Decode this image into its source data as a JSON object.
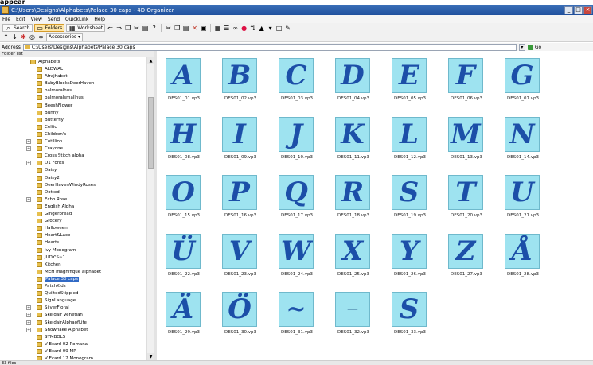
{
  "window": {
    "title": "C:\\Users\\Designs\\Alphabets\\Palace 30 caps - 4D Organizer"
  },
  "menu": [
    "File",
    "Edit",
    "View",
    "Send",
    "QuickLink",
    "Help"
  ],
  "toolbar": {
    "search_label": "Search",
    "folders_label": "Folders",
    "worksheet_label": "Worksheet",
    "accessories_label": "Accessories"
  },
  "address": {
    "label": "Address",
    "value": "C:\\Users\\Designs\\Alphabets\\Palace 30 caps",
    "go_label": "Go"
  },
  "folder_list_header": "Folder list",
  "tree": {
    "root": "Alphabets",
    "folders": [
      "ALDWAL",
      "Afrajhabet",
      "BabyBlocksDeerHaven",
      "balmoralhus",
      "balmoralsmallhus",
      "BeeshFlower",
      "Bunny",
      "Butterfly",
      "Celtic",
      "Children's",
      "Cotillion",
      "Crayone",
      "Cross Stitch alpha",
      "D1 Fonts",
      "Daisy",
      "Daisy2",
      "DeerHavenWindyRoses",
      "Dotted",
      "Echo Rose",
      "English Alpha",
      "Gingerbread",
      "Grocery",
      "Halloween",
      "Heart&Lace",
      "Hearts",
      "Ivy Monogram",
      "JUDY'S~1",
      "Kitchen",
      "MEH magnifique alphabet",
      "Palace 30 caps",
      "PatchKids",
      "QuiltedStippled",
      "SignLanguage",
      "SilverFloral",
      "Skeldair Venetian",
      "SkeldairAlphaofLife",
      "Snowflake Alphabet",
      "SYMBOLS",
      "V Ecard 02 Romana",
      "V Ecard 09 MP",
      "V Ecard 12 Monogram"
    ],
    "selected": "Palace 30 caps"
  },
  "files": [
    {
      "name": "DES01_01.vp3",
      "glyph": "A"
    },
    {
      "name": "DES01_02.vp3",
      "glyph": "B"
    },
    {
      "name": "DES01_03.vp3",
      "glyph": "C"
    },
    {
      "name": "DES01_04.vp3",
      "glyph": "D"
    },
    {
      "name": "DES01_05.vp3",
      "glyph": "E"
    },
    {
      "name": "DES01_06.vp3",
      "glyph": "F"
    },
    {
      "name": "DES01_07.vp3",
      "glyph": "G"
    },
    {
      "name": "DES01_08.vp3",
      "glyph": "H"
    },
    {
      "name": "DES01_09.vp3",
      "glyph": "I"
    },
    {
      "name": "DES01_10.vp3",
      "glyph": "J"
    },
    {
      "name": "DES01_11.vp3",
      "glyph": "K"
    },
    {
      "name": "DES01_12.vp3",
      "glyph": "L"
    },
    {
      "name": "DES01_13.vp3",
      "glyph": "M"
    },
    {
      "name": "DES01_14.vp3",
      "glyph": "N"
    },
    {
      "name": "DES01_15.vp3",
      "glyph": "O"
    },
    {
      "name": "DES01_16.vp3",
      "glyph": "P"
    },
    {
      "name": "DES01_17.vp3",
      "glyph": "Q"
    },
    {
      "name": "DES01_18.vp3",
      "glyph": "R"
    },
    {
      "name": "DES01_19.vp3",
      "glyph": "S"
    },
    {
      "name": "DES01_20.vp3",
      "glyph": "T"
    },
    {
      "name": "DES01_21.vp3",
      "glyph": "U"
    },
    {
      "name": "DES01_22.vp3",
      "glyph": "Ü"
    },
    {
      "name": "DES01_23.vp3",
      "glyph": "V"
    },
    {
      "name": "DES01_24.vp3",
      "glyph": "W"
    },
    {
      "name": "DES01_25.vp3",
      "glyph": "X"
    },
    {
      "name": "DES01_26.vp3",
      "glyph": "Y"
    },
    {
      "name": "DES01_27.vp3",
      "glyph": "Z"
    },
    {
      "name": "DES01_28.vp3",
      "glyph": "Å"
    },
    {
      "name": "DES01_29.vp3",
      "glyph": "Ä"
    },
    {
      "name": "DES01_30.vp3",
      "glyph": "Ö"
    },
    {
      "name": "DES01_31.vp3",
      "glyph": "~"
    },
    {
      "name": "DES01_32.vp3",
      "glyph": "—"
    },
    {
      "name": "DES01_33.vp3",
      "glyph": "S"
    }
  ],
  "status": {
    "text": "33 files"
  },
  "colors": {
    "thumb_bg": "#9ee3f0",
    "glyph": "#1c4fa8",
    "selection": "#316ac5"
  }
}
